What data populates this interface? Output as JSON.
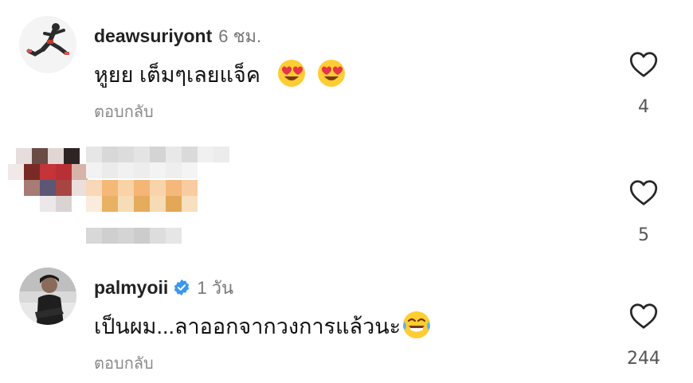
{
  "comments": [
    {
      "username": "deawsuriyont",
      "time": "6 ชม.",
      "text": "หูยย เต็มๆเลยแจ็ค",
      "emojis": [
        "heart-eyes-emoji",
        "heart-eyes-emoji"
      ],
      "reply_label": "ตอบกลับ",
      "likes": "4",
      "avatar": "runner-photo"
    },
    {
      "username": "",
      "time": "",
      "text": "",
      "pixelated": true,
      "likes": "5"
    },
    {
      "username": "palmyoii",
      "verified": true,
      "time": "1 วัน",
      "text": "เป็นผม...ลาออกจากวงการแล้วนะ",
      "emojis": [
        "tears-of-joy-emoji"
      ],
      "reply_label": "ตอบกลับ",
      "likes": "244",
      "avatar": "person-photo"
    }
  ],
  "colors": {
    "verified_blue": "#3897f0",
    "emoji_yellow": "#ffcc33",
    "heart_red": "#e8334a",
    "secondary_text": "#8a8a8a"
  },
  "icons": [
    "heart-outline-icon",
    "verified-badge-icon"
  ]
}
